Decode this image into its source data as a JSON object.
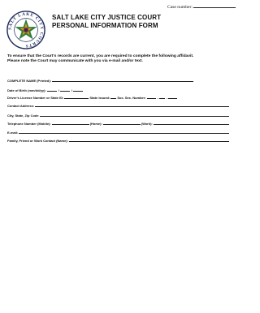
{
  "header": {
    "case_number_label": "Case number:",
    "title_line1": "SALT LAKE CITY JUSTICE COURT",
    "title_line2": "PERSONAL INFORMATION FORM",
    "seal_text": "SALT LAKE CITY COURTS"
  },
  "intro": {
    "line1": "To ensure that the Court's records are current, you are required to complete the following affidavit.",
    "line2": "Please note the Court may communicate with you via e-mail and/or text."
  },
  "fields": {
    "complete_name": "COMPLETE NAME (Printed):",
    "dob": "Date of Birth (mm/dd/yy):",
    "dob_sep": "/",
    "license": "Driver's License Number or State ID:",
    "state_issued": "State issued:",
    "ssn": "Soc. Sec. Number:",
    "ssn_sep": "-",
    "contact_address": "Contact Address:",
    "city_state_zip": "City, State, Zip Code",
    "telephone_mobile": "Telephone Number (Mobile):",
    "home": "(Home):",
    "work": "(Work):",
    "email": "E-mail:",
    "emergency_contact": "Family, Friend or Work Contact (Name):"
  },
  "colors": {
    "seal_star": "#2e7d3a",
    "seal_ring": "#1f2a5a",
    "seal_red": "#c0392b",
    "seal_gold": "#d4a017"
  }
}
